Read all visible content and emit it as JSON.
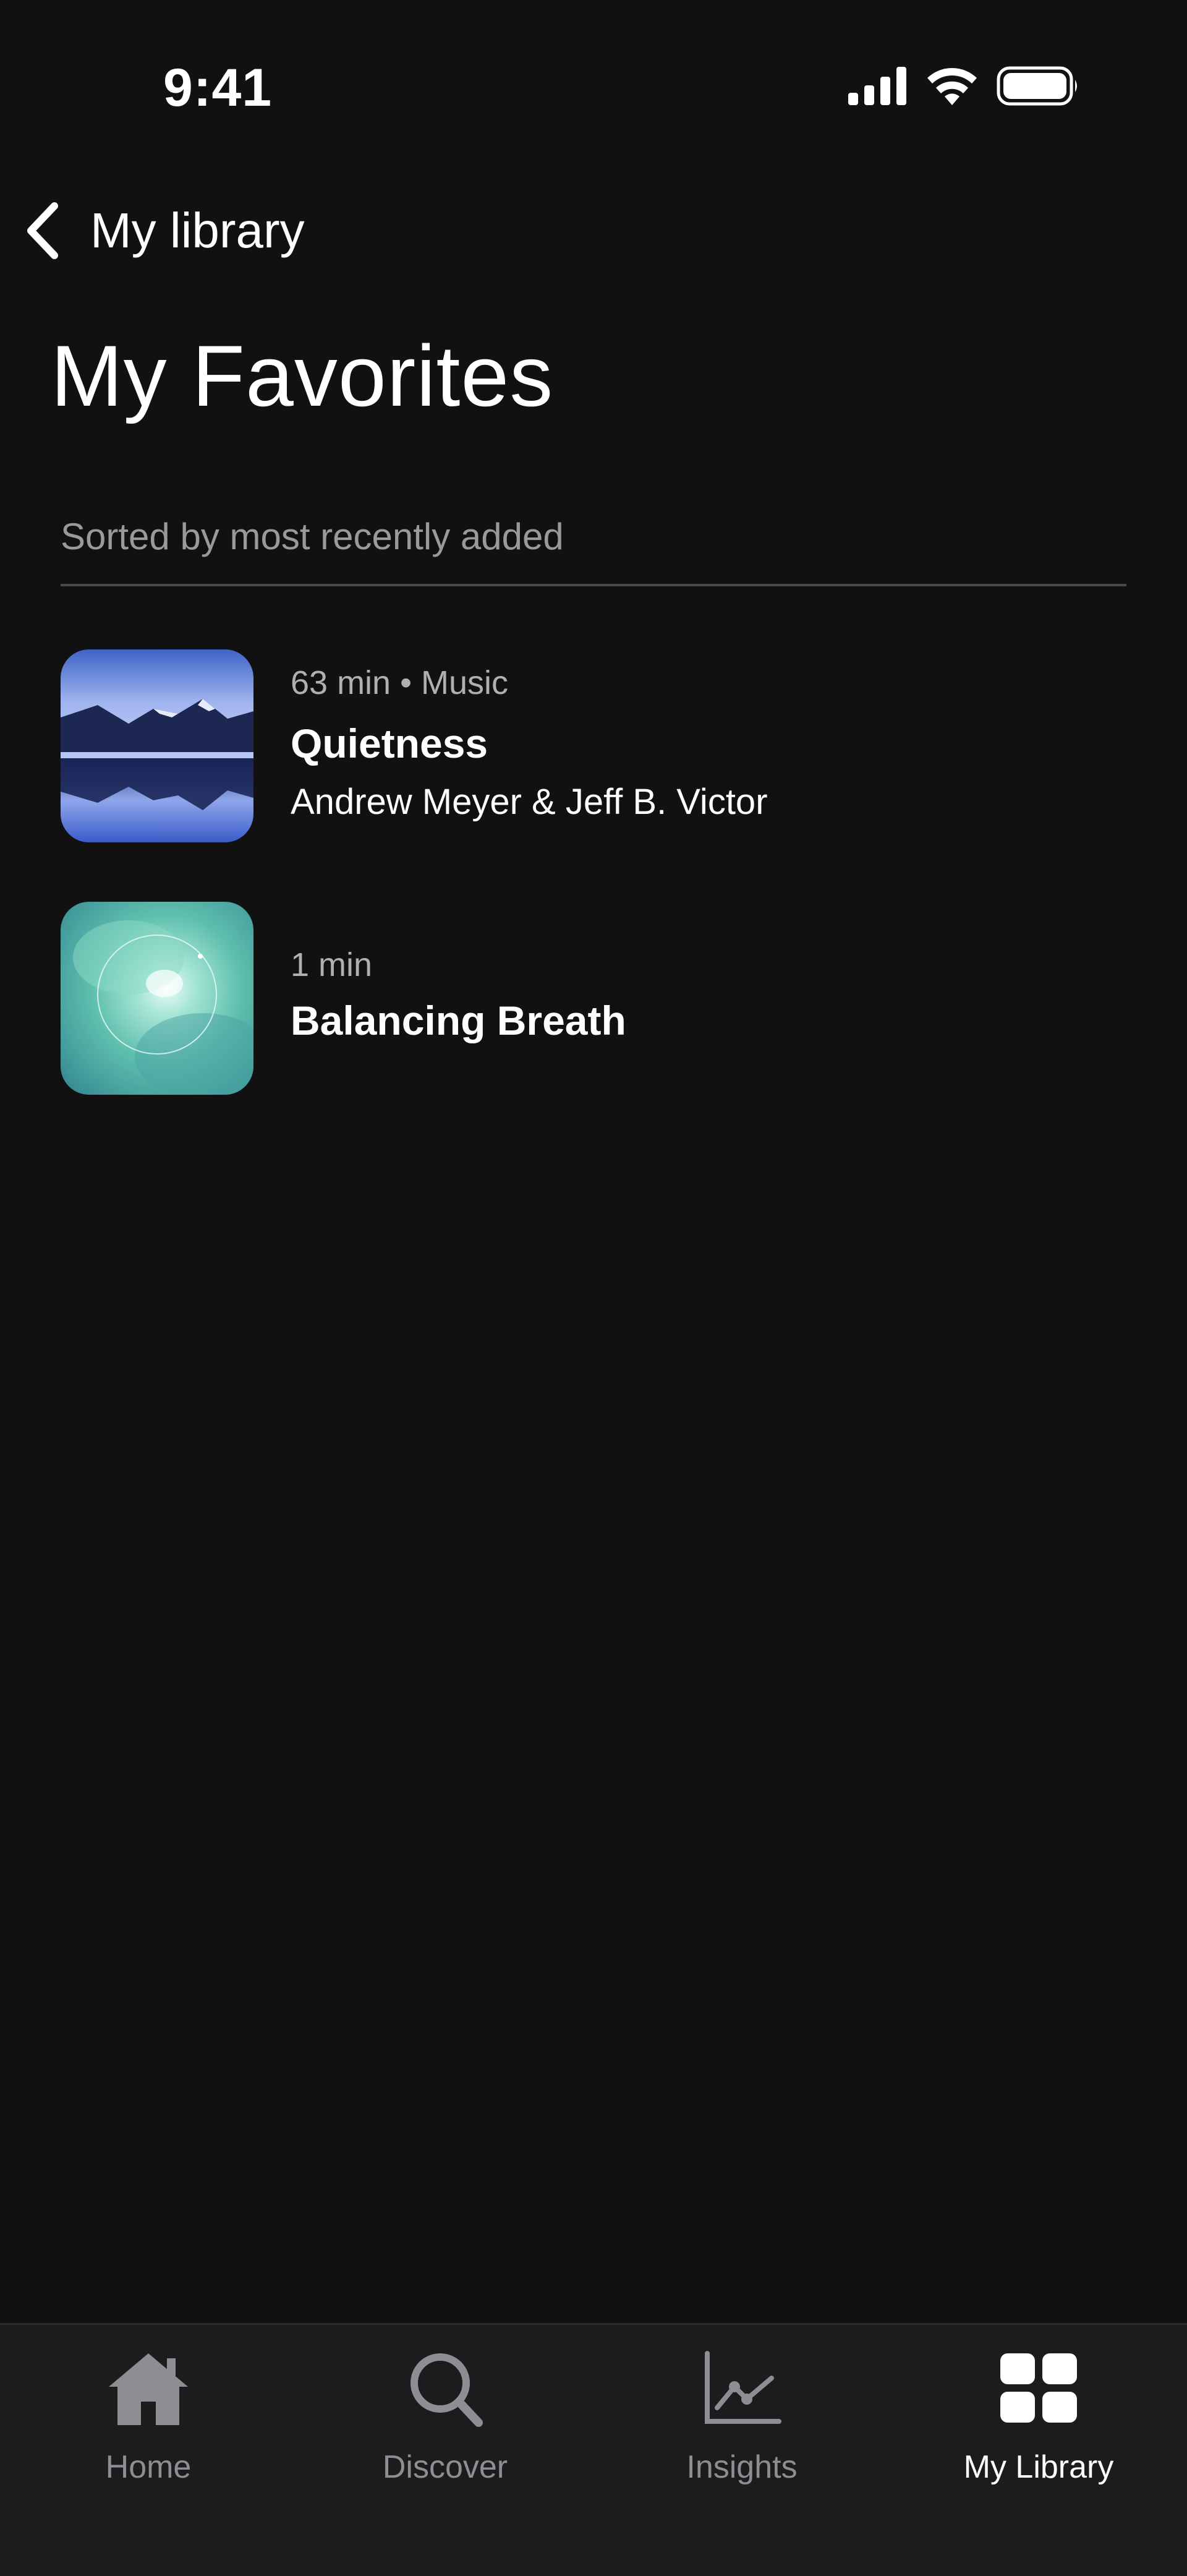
{
  "status_bar": {
    "time": "9:41"
  },
  "nav": {
    "back_label": "My library"
  },
  "page": {
    "title": "My Favorites",
    "sort_label": "Sorted by most recently added"
  },
  "items": [
    {
      "meta": "63 min • Music",
      "title": "Quietness",
      "artist": "Andrew Meyer & Jeff B. Victor",
      "thumbnail": "mountain-lake-image"
    },
    {
      "meta": "1 min",
      "title": "Balancing Breath",
      "thumbnail": "teal-breath-orb-image"
    }
  ],
  "tabs": [
    {
      "label": "Home",
      "icon": "home-icon",
      "active": false
    },
    {
      "label": "Discover",
      "icon": "search-icon",
      "active": false
    },
    {
      "label": "Insights",
      "icon": "chart-icon",
      "active": false
    },
    {
      "label": "My Library",
      "icon": "grid-icon",
      "active": true
    }
  ],
  "colors": {
    "background": "#111112",
    "tab_bar": "#1c1c1e",
    "inactive_tab": "#8e8e92",
    "active_tab": "#ffffff",
    "secondary_text": "#9a9a9c"
  }
}
